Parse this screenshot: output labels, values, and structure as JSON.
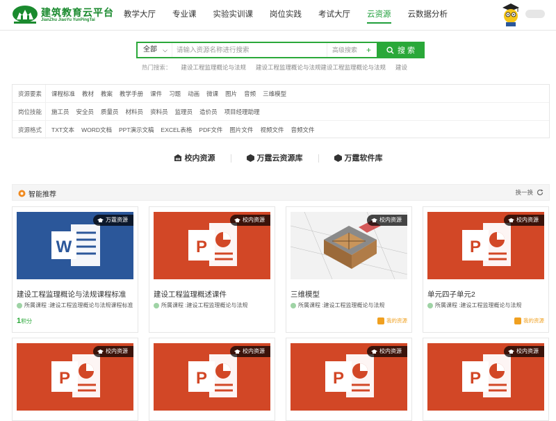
{
  "brand": {
    "title": "建筑教育云平台",
    "subtitle": "JianZhu JiaoYu YunPingTai"
  },
  "nav": [
    {
      "label": "教学大厅",
      "active": false
    },
    {
      "label": "专业课",
      "active": false
    },
    {
      "label": "实验实训课",
      "active": false
    },
    {
      "label": "岗位实践",
      "active": false
    },
    {
      "label": "考试大厅",
      "active": false
    },
    {
      "label": "云资源",
      "active": true
    },
    {
      "label": "云数据分析",
      "active": false
    }
  ],
  "search": {
    "scope": "全部",
    "placeholder": "请输入资源名称进行搜索",
    "advanced": "高级搜索",
    "button": "搜 索"
  },
  "hot": {
    "label": "热门搜索：",
    "items": [
      "建设工程监理概论与法规",
      "建设工程监理概论与法规建设工程监理概论与法规",
      "建设"
    ]
  },
  "filters": [
    {
      "label": "资源要素",
      "items": [
        "课程标准",
        "教材",
        "教案",
        "教学手册",
        "课件",
        "习题",
        "动画",
        "微课",
        "图片",
        "音频",
        "三维模型"
      ]
    },
    {
      "label": "岗位技能",
      "items": [
        "施工员",
        "安全员",
        "质量员",
        "材料员",
        "资料员",
        "监理员",
        "造价员",
        "项目经理助理"
      ]
    },
    {
      "label": "资源格式",
      "items": [
        "TXT文本",
        "WORD文档",
        "PPT演示文稿",
        "EXCEL表格",
        "PDF文件",
        "图片文件",
        "视频文件",
        "音频文件"
      ]
    }
  ],
  "tabs": [
    "校内资源",
    "万霆云资源库",
    "万霆软件库"
  ],
  "recommend": {
    "title": "智能推荐",
    "refresh": "换一换"
  },
  "cards": [
    {
      "type": "word",
      "badge": "万霆资源",
      "title": "建设工程监理概论与法规课程标准",
      "meta": "所属课程 :建设工程监理概论与法规课程标准",
      "points_num": "1",
      "points_unit": "积分",
      "mine": ""
    },
    {
      "type": "ppt",
      "badge": "校内资源",
      "title": "建设工程监理概述课件",
      "meta": "所属课程 :建设工程监理概论与法规",
      "points_num": "",
      "points_unit": "",
      "mine": ""
    },
    {
      "type": "model",
      "badge": "校内资源",
      "title": "三维模型",
      "meta": "所属课程 :建设工程监理概论与法规",
      "points_num": "",
      "points_unit": "",
      "mine": "我的资源"
    },
    {
      "type": "ppt",
      "badge": "校内资源",
      "title": "单元四子单元2",
      "meta": "所属课程 :建设工程监理概论与法规",
      "points_num": "",
      "points_unit": "",
      "mine": "我的资源"
    },
    {
      "type": "ppt",
      "badge": "校内资源",
      "title": "",
      "meta": "",
      "points_num": "",
      "points_unit": "",
      "mine": ""
    },
    {
      "type": "ppt",
      "badge": "校内资源",
      "title": "",
      "meta": "",
      "points_num": "",
      "points_unit": "",
      "mine": ""
    },
    {
      "type": "ppt",
      "badge": "校内资源",
      "title": "",
      "meta": "",
      "points_num": "",
      "points_unit": "",
      "mine": ""
    },
    {
      "type": "ppt",
      "badge": "校内资源",
      "title": "",
      "meta": "",
      "points_num": "",
      "points_unit": "",
      "mine": ""
    }
  ],
  "colors": {
    "accent": "#2aa839",
    "ppt": "#d24726",
    "word": "#2b579a",
    "mine": "#f0a020"
  }
}
